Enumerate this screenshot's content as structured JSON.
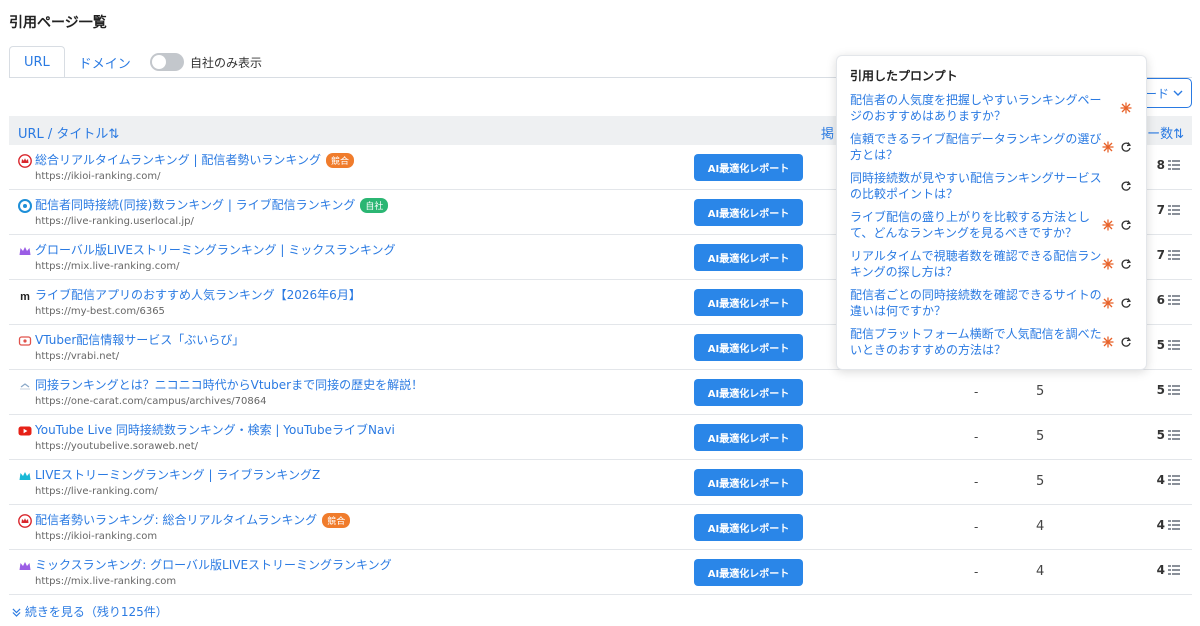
{
  "page_title": "引用ページ一覧",
  "tabs": [
    {
      "label": "URL",
      "active": true
    },
    {
      "label": "ドメイン",
      "active": false
    }
  ],
  "toggle": {
    "label": "自社のみ表示",
    "on": false
  },
  "download_label": "ード",
  "table": {
    "headers": {
      "url_title": "URL / タイトル⇅",
      "mid": "掲",
      "count": "ー数⇅"
    },
    "ai_button_label": "AI最適化レポート",
    "rows": [
      {
        "favicon": "crown-red-icon",
        "title": "総合リアルタイムランキング | 配信者勢いランキング",
        "badge": "競合",
        "badge_color": "#f07c2c",
        "url": "https://ikioi-ranking.com/",
        "dash": "",
        "num": "",
        "count": "8"
      },
      {
        "favicon": "userlocal-icon",
        "title": "配信者同時接続(同接)数ランキング | ライブ配信ランキング",
        "badge": "自社",
        "badge_color": "#2bb673",
        "url": "https://live-ranking.userlocal.jp/",
        "dash": "",
        "num": "",
        "count": "7"
      },
      {
        "favicon": "crown-purple-icon",
        "title": "グローバル版LIVEストリーミングランキング | ミックスランキング",
        "badge": "",
        "badge_color": "",
        "url": "https://mix.live-ranking.com/",
        "dash": "",
        "num": "",
        "count": "7"
      },
      {
        "favicon": "m-logo-icon",
        "title": "ライブ配信アプリのおすすめ人気ランキング【2026年6月】",
        "badge": "",
        "badge_color": "",
        "url": "https://my-best.com/6365",
        "dash": "",
        "num": "",
        "count": "6"
      },
      {
        "favicon": "vrabi-icon",
        "title": "VTuber配信情報サービス「ぶいらび」",
        "badge": "",
        "badge_color": "",
        "url": "https://vrabi.net/",
        "dash": "",
        "num": "",
        "count": "5"
      },
      {
        "favicon": "carat-icon",
        "title": "同接ランキングとは？ニコニコ時代からVtuberまで同接の歴史を解説！",
        "badge": "",
        "badge_color": "",
        "url": "https://one-carat.com/campus/archives/70864",
        "dash": "-",
        "num": "5",
        "count": "5"
      },
      {
        "favicon": "youtube-icon",
        "title": "YouTube Live 同時接続数ランキング・検索 | YouTubeライブNavi",
        "badge": "",
        "badge_color": "",
        "url": "https://youtubelive.soraweb.net/",
        "dash": "-",
        "num": "5",
        "count": "5"
      },
      {
        "favicon": "crown-cyan-icon",
        "title": "LIVEストリーミングランキング | ライブランキングZ",
        "badge": "",
        "badge_color": "",
        "url": "https://live-ranking.com/",
        "dash": "-",
        "num": "5",
        "count": "4"
      },
      {
        "favicon": "crown-red-icon",
        "title": "配信者勢いランキング: 総合リアルタイムランキング",
        "badge": "競合",
        "badge_color": "#f07c2c",
        "url": "https://ikioi-ranking.com",
        "dash": "-",
        "num": "4",
        "count": "4"
      },
      {
        "favicon": "crown-purple-icon",
        "title": "ミックスランキング: グローバル版LIVEストリーミングランキング",
        "badge": "",
        "badge_color": "",
        "url": "https://mix.live-ranking.com",
        "dash": "-",
        "num": "4",
        "count": "4"
      }
    ]
  },
  "more_link": "続きを見る（残り125件）",
  "popover": {
    "title": "引用したプロンプト",
    "prompts": [
      {
        "text": "配信者の人気度を把握しやすいランキングページのおすすめはありますか？",
        "sun": true,
        "cycle": false
      },
      {
        "text": "信頼できるライブ配信データランキングの選び方とは？",
        "sun": true,
        "cycle": true
      },
      {
        "text": "同時接続数が見やすい配信ランキングサービスの比較ポイントは？",
        "sun": false,
        "cycle": true
      },
      {
        "text": "ライブ配信の盛り上がりを比較する方法として、どんなランキングを見るべきですか？",
        "sun": true,
        "cycle": true
      },
      {
        "text": "リアルタイムで視聴者数を確認できる配信ランキングの探し方は？",
        "sun": true,
        "cycle": true
      },
      {
        "text": "配信者ごとの同時接続数を確認できるサイトの違いは何ですか？",
        "sun": true,
        "cycle": true
      },
      {
        "text": "配信プラットフォーム横断で人気配信を調べたいときのおすすめの方法は？",
        "sun": true,
        "cycle": true
      }
    ]
  },
  "colors": {
    "accent": "#2a7ae2",
    "button": "#2a86e8",
    "competitor": "#f07c2c",
    "own": "#2bb673",
    "sun": "#e8632b"
  }
}
